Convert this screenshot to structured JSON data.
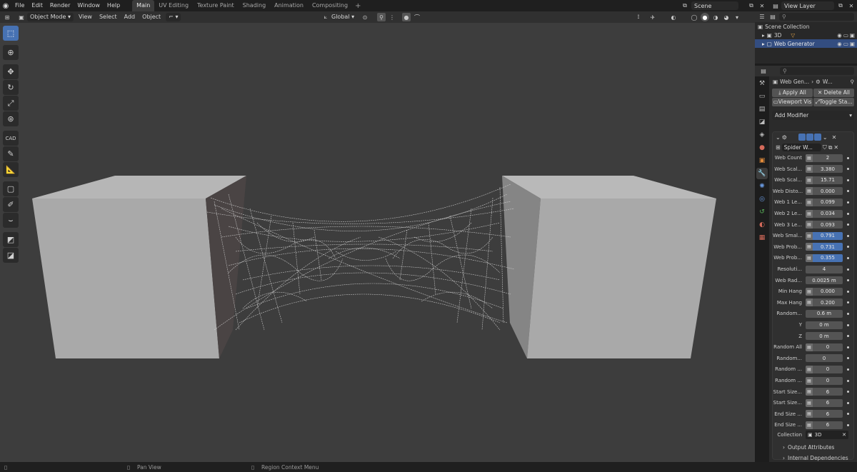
{
  "topbar": {
    "menus": [
      "File",
      "Edit",
      "Render",
      "Window",
      "Help"
    ],
    "workspaces": [
      "Main",
      "UV Editing",
      "Texture Paint",
      "Shading",
      "Animation",
      "Compositing"
    ],
    "active_workspace": "Main",
    "scene": "Scene",
    "view_layer": "View Layer"
  },
  "viewport_header": {
    "mode": "Object Mode",
    "menus": [
      "View",
      "Select",
      "Add",
      "Object"
    ],
    "transform_orientation": "Global"
  },
  "status_bar": {
    "pan_view": "Pan View",
    "region_context_menu": "Region Context Menu"
  },
  "outliner": {
    "root": "Scene Collection",
    "items": [
      {
        "name": "3D",
        "selected": false
      },
      {
        "name": "Web Generator",
        "selected": true
      }
    ]
  },
  "properties": {
    "breadcrumb_object": "Web Gen...",
    "breadcrumb_modifier": "W...",
    "apply_all": "Apply All",
    "delete_all": "Delete All",
    "viewport_vis": "Viewport Vis",
    "toggle_stack": "Toggle Sta...",
    "add_modifier": "Add Modifier",
    "modifier_name": "Spider W...",
    "params": [
      {
        "label": "Web Count",
        "value": "2",
        "icon": true
      },
      {
        "label": "Web Scal...",
        "value": "3.380",
        "icon": true
      },
      {
        "label": "Web Scal...",
        "value": "15.71",
        "icon": true
      },
      {
        "label": "Web Disto...",
        "value": "0.000",
        "icon": true
      },
      {
        "label": "Web 1 Le...",
        "value": "0.099",
        "icon": true
      },
      {
        "label": "Web 2 Le...",
        "value": "0.034",
        "icon": true
      },
      {
        "label": "Web 3 Le...",
        "value": "0.093",
        "icon": true
      },
      {
        "label": "Web Smal...",
        "value": "0.791",
        "icon": true,
        "highlight": true
      },
      {
        "label": "Web Prob...",
        "value": "0.731",
        "icon": true,
        "highlight": true
      },
      {
        "label": "Web Prob...",
        "value": "0.355",
        "icon": true,
        "highlight": true
      },
      {
        "label": "Resoluti...",
        "value": "4",
        "icon": false
      },
      {
        "label": "Web Rad...",
        "value": "0.0025 m",
        "icon": false
      },
      {
        "label": "Min Hang",
        "value": "0.000",
        "icon": true
      },
      {
        "label": "Max Hang",
        "value": "0.200",
        "icon": true
      },
      {
        "label": "Random...",
        "value": "0.6 m",
        "icon": false
      },
      {
        "label": "Y",
        "value": "0 m",
        "icon": false
      },
      {
        "label": "Z",
        "value": "0 m",
        "icon": false
      },
      {
        "label": "Random All",
        "value": "0",
        "icon": true
      },
      {
        "label": "Random...",
        "value": "0",
        "icon": false
      },
      {
        "label": "Random ...",
        "value": "0",
        "icon": true
      },
      {
        "label": "Random ...",
        "value": "0",
        "icon": true
      },
      {
        "label": "Start Size...",
        "value": "6",
        "icon": true
      },
      {
        "label": "Start Size...",
        "value": "6",
        "icon": true
      },
      {
        "label": "End Size ...",
        "value": "6",
        "icon": true
      },
      {
        "label": "End Size ...",
        "value": "6",
        "icon": true
      }
    ],
    "collection_label": "Collection",
    "collection_value": "3D",
    "output_attributes": "Output Attributes",
    "internal_dependencies": "Internal Dependencies"
  },
  "colors": {
    "accent": "#4772b3",
    "viewport_bg": "#3d3d3d",
    "cube_front": "#a9a9a9",
    "cube_side": "#828282",
    "cube_top": "#b7b7b7"
  }
}
